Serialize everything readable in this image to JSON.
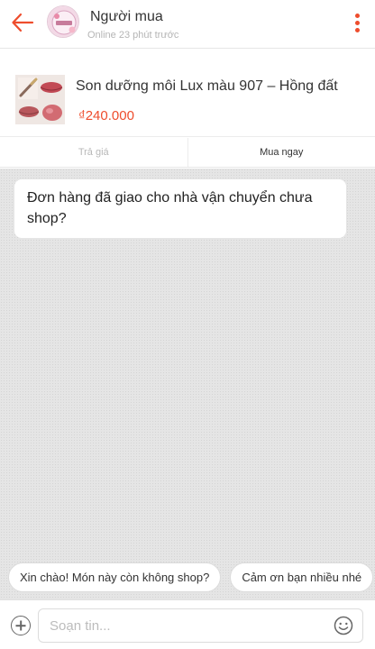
{
  "header": {
    "name": "Người mua",
    "status": "Online 23 phút trước",
    "back_icon": "arrow-left-icon",
    "more_icon": "more-vertical-icon",
    "accent_color": "#ee4d2d"
  },
  "product": {
    "name": "Son dưỡng môi Lux màu 907 – Hồng đất",
    "price": "₫240.000"
  },
  "tabs": {
    "offer_label": "Trả giá",
    "buy_now_label": "Mua ngay"
  },
  "messages": [
    {
      "text": "Đơn hàng đã giao cho nhà vận chuyển chưa shop?"
    }
  ],
  "quick_replies": [
    "Xin chào! Món này còn không shop?",
    "Cảm ơn bạn nhiều nhé"
  ],
  "composer": {
    "placeholder": "Soạn tin...",
    "add_icon": "plus-circle-icon",
    "emoji_icon": "emoji-icon"
  }
}
